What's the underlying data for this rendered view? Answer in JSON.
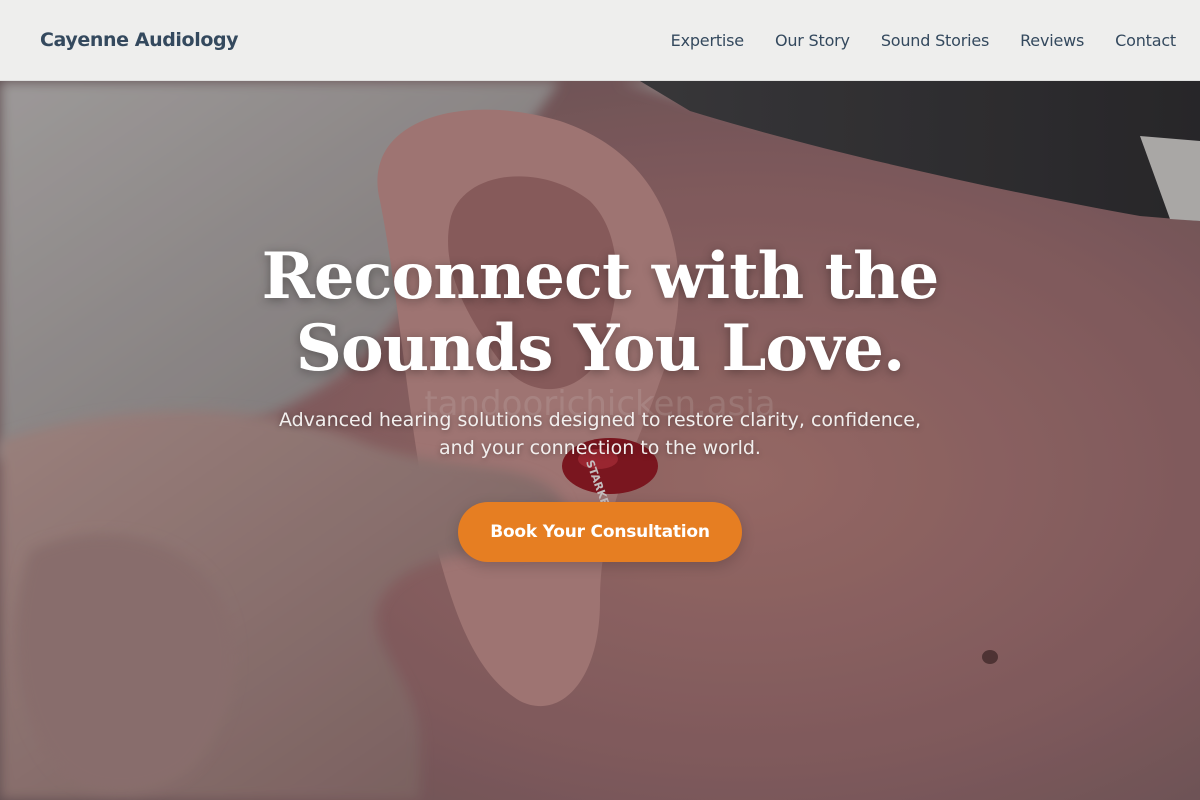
{
  "header": {
    "brand": "Cayenne Audiology",
    "nav": [
      {
        "label": "Expertise"
      },
      {
        "label": "Our Story"
      },
      {
        "label": "Sound Stories"
      },
      {
        "label": "Reviews"
      },
      {
        "label": "Contact"
      }
    ]
  },
  "hero": {
    "title_lines": [
      "Reconnect with the",
      "Sounds You Love."
    ],
    "subtitle_lines": [
      "Advanced hearing solutions designed to restore clarity, confidence,",
      "and your connection to the world."
    ],
    "cta_label": "Book Your Consultation",
    "background_image": "photo-close-up-ear-hearing-aid-icon",
    "hearing_aid_text": "STARKEY",
    "watermark_text": "tandoorichicken.asia"
  },
  "colors": {
    "accent": "#e67e22",
    "header_bg": "#f3f3f2",
    "nav_text": "#34495e",
    "hero_text": "#ffffff"
  }
}
